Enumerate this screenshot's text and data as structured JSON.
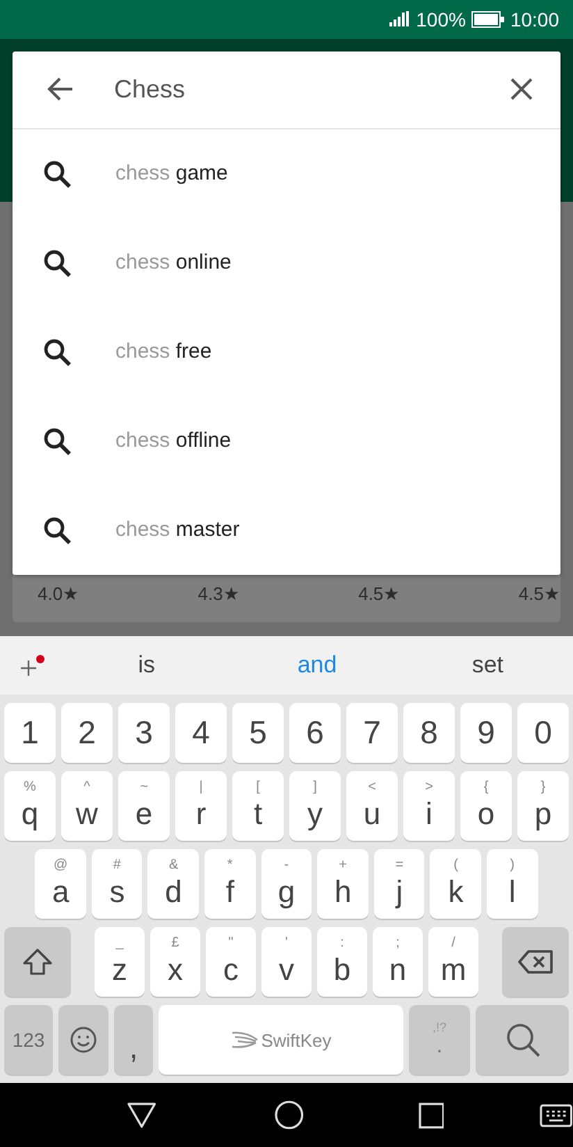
{
  "status_bar": {
    "battery": "100%",
    "time": "10:00"
  },
  "search": {
    "query": "Chess"
  },
  "suggestions": [
    {
      "typed": "chess",
      "completion": "game"
    },
    {
      "typed": "chess",
      "completion": "online"
    },
    {
      "typed": "chess",
      "completion": "free"
    },
    {
      "typed": "chess",
      "completion": "offline"
    },
    {
      "typed": "chess",
      "completion": "master"
    }
  ],
  "ratings": [
    "4.0★",
    "4.3★",
    "4.5★",
    "4.5★"
  ],
  "keyboard": {
    "predictions": [
      {
        "text": "is",
        "selected": false
      },
      {
        "text": "and",
        "selected": true
      },
      {
        "text": "set",
        "selected": false
      }
    ],
    "number_row": [
      "1",
      "2",
      "3",
      "4",
      "5",
      "6",
      "7",
      "8",
      "9",
      "0"
    ],
    "rows": [
      [
        {
          "main": "q",
          "alt": "%"
        },
        {
          "main": "w",
          "alt": "^"
        },
        {
          "main": "e",
          "alt": "~"
        },
        {
          "main": "r",
          "alt": "|"
        },
        {
          "main": "t",
          "alt": "["
        },
        {
          "main": "y",
          "alt": "]"
        },
        {
          "main": "u",
          "alt": "<"
        },
        {
          "main": "i",
          "alt": ">"
        },
        {
          "main": "o",
          "alt": "{"
        },
        {
          "main": "p",
          "alt": "}"
        }
      ],
      [
        {
          "main": "a",
          "alt": "@"
        },
        {
          "main": "s",
          "alt": "#"
        },
        {
          "main": "d",
          "alt": "&"
        },
        {
          "main": "f",
          "alt": "*"
        },
        {
          "main": "g",
          "alt": "-"
        },
        {
          "main": "h",
          "alt": "+"
        },
        {
          "main": "j",
          "alt": "="
        },
        {
          "main": "k",
          "alt": "("
        },
        {
          "main": "l",
          "alt": ")"
        }
      ],
      [
        {
          "main": "z",
          "alt": "_"
        },
        {
          "main": "x",
          "alt": "£"
        },
        {
          "main": "c",
          "alt": "\""
        },
        {
          "main": "v",
          "alt": "'"
        },
        {
          "main": "b",
          "alt": ":"
        },
        {
          "main": "n",
          "alt": ";"
        },
        {
          "main": "m",
          "alt": "/"
        }
      ]
    ],
    "numbers_key": "123",
    "comma_key": ",",
    "space_brand": "SwiftKey",
    "period_key": {
      "main": ".",
      "alt": ",!?"
    }
  }
}
